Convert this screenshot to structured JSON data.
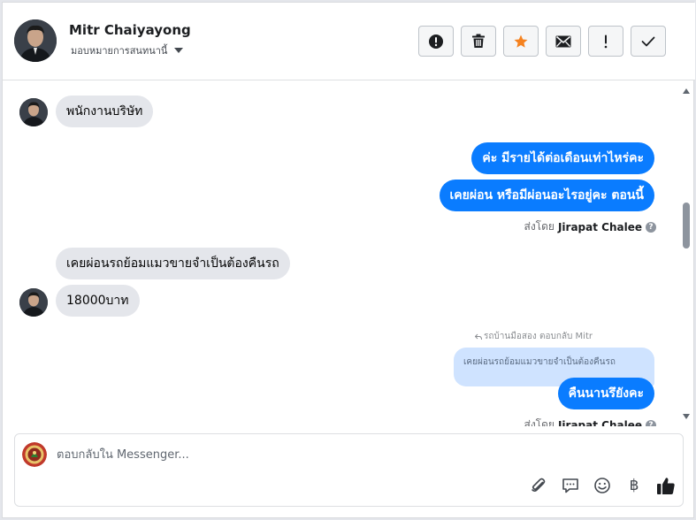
{
  "header": {
    "contact_name": "Mitr Chaiyayong",
    "assign_label": "มอบหมายการสนทนานี้",
    "actions": [
      {
        "name": "spam-button",
        "icon": "exclamation-circle-icon"
      },
      {
        "name": "delete-button",
        "icon": "trash-icon"
      },
      {
        "name": "star-button",
        "icon": "star-icon"
      },
      {
        "name": "mark-unread-button",
        "icon": "envelope-icon"
      },
      {
        "name": "follow-up-button",
        "icon": "exclamation-icon"
      },
      {
        "name": "mark-done-button",
        "icon": "checkmark-icon"
      }
    ]
  },
  "messages": {
    "m1": "พนักงานบริษัท",
    "m2": "ค่ะ มีรายได้ต่อเดือนเท่าไหร่คะ",
    "m3": "เคยผ่อน หรือมีผ่อนอะไรอยู่คะ ตอนนี้",
    "sent_by_prefix": "ส่งโดย",
    "sent_by_name": "Jirapat Chalee",
    "m4": "เคยผ่อนรถย้อมแมวขายจำเป็นต้องคืนรถ",
    "m5": "18000บาท",
    "reply_hint": "รถบ้านมือสอง ตอบกลับ Mitr",
    "quoted_text": "เคยผ่อนรถย้อมแมวขายจำเป็นต้องคืนรถ",
    "m6": "คืนนานรึยังคะ",
    "sent_by_prefix_2": "ส่งโดย",
    "sent_by_name_2": "Jirapat Chalee"
  },
  "composer": {
    "placeholder": "ตอบกลับใน Messenger...",
    "tools": [
      "attachment-icon",
      "saved-reply-icon",
      "emoji-icon",
      "baht-icon",
      "thumbs-up-icon"
    ],
    "baht_symbol": "฿"
  },
  "colors": {
    "outgoing_bubble": "#0a7cff",
    "incoming_bubble": "#e4e6eb",
    "star": "#f5821f"
  }
}
